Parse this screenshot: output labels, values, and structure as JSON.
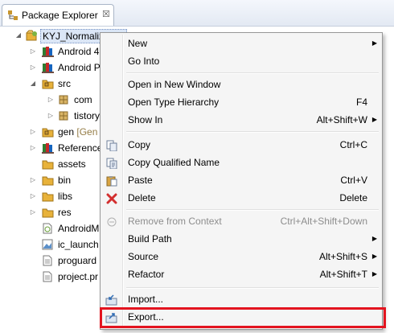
{
  "view": {
    "tab_label": "Package Explorer",
    "close_glyph": "☒"
  },
  "tree": {
    "project": "KYJ_Normalization",
    "items": [
      {
        "label": "Android 4",
        "icon": "library-icon"
      },
      {
        "label": "Android P",
        "icon": "library-icon"
      },
      {
        "label": "src",
        "icon": "source-folder-icon"
      },
      {
        "label": "com",
        "icon": "package-icon"
      },
      {
        "label": "tistory",
        "icon": "package-icon"
      },
      {
        "label": "gen",
        "deco": "[Gen",
        "icon": "source-folder-icon"
      },
      {
        "label": "Reference",
        "icon": "library-icon"
      },
      {
        "label": "assets",
        "icon": "folder-icon"
      },
      {
        "label": "bin",
        "icon": "folder-icon"
      },
      {
        "label": "libs",
        "icon": "folder-icon"
      },
      {
        "label": "res",
        "icon": "folder-icon"
      },
      {
        "label": "AndroidM",
        "icon": "android-file-icon"
      },
      {
        "label": "ic_launch",
        "icon": "image-file-icon"
      },
      {
        "label": "proguard",
        "icon": "text-file-icon"
      },
      {
        "label": "project.pr",
        "icon": "text-file-icon"
      }
    ]
  },
  "menu": {
    "items": [
      {
        "label": "New",
        "submenu": true
      },
      {
        "label": "Go Into"
      },
      {
        "label": "Open in New Window"
      },
      {
        "label": "Open Type Hierarchy",
        "accel": "F4"
      },
      {
        "label": "Show In",
        "accel": "Alt+Shift+W",
        "submenu": true
      },
      {
        "label": "Copy",
        "accel": "Ctrl+C",
        "icon": "copy-icon"
      },
      {
        "label": "Copy Qualified Name",
        "icon": "copy-qualified-icon"
      },
      {
        "label": "Paste",
        "accel": "Ctrl+V",
        "icon": "paste-icon"
      },
      {
        "label": "Delete",
        "accel": "Delete",
        "icon": "delete-icon"
      },
      {
        "label": "Remove from Context",
        "accel": "Ctrl+Alt+Shift+Down",
        "icon": "remove-context-icon",
        "disabled": true
      },
      {
        "label": "Build Path",
        "submenu": true
      },
      {
        "label": "Source",
        "accel": "Alt+Shift+S",
        "submenu": true
      },
      {
        "label": "Refactor",
        "accel": "Alt+Shift+T",
        "submenu": true
      },
      {
        "label": "Import...",
        "icon": "import-icon"
      },
      {
        "label": "Export...",
        "icon": "export-icon"
      }
    ]
  },
  "colors": {
    "highlight": "#e3141f",
    "library_books": "#2e7d32",
    "folder": "#e8b23a",
    "package": "#8b6b2b"
  }
}
